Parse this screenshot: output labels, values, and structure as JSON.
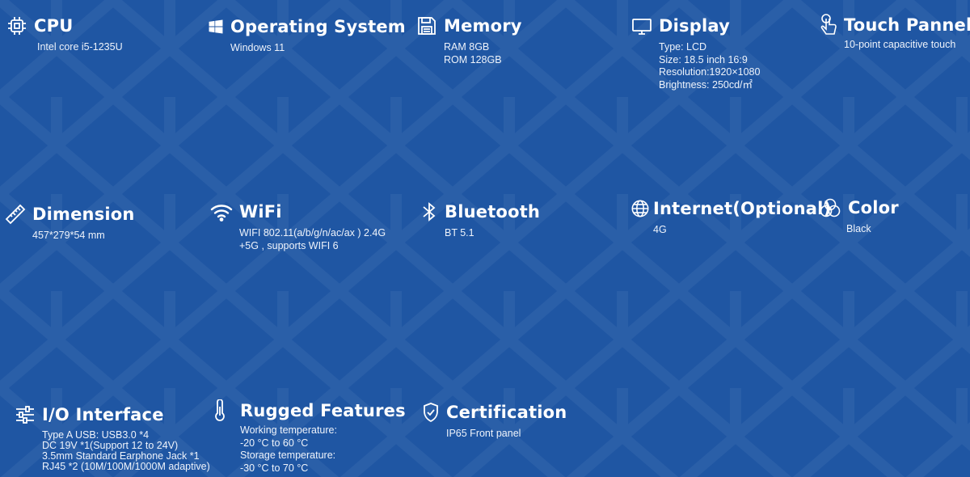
{
  "colors": {
    "background": "#1f56a3",
    "text": "#ffffff"
  },
  "specs": {
    "cpu": {
      "icon": "cpu-icon",
      "title": "CPU",
      "lines": [
        "Intel core i5-1235U"
      ]
    },
    "os": {
      "icon": "windows-icon",
      "title": "Operating System",
      "lines": [
        "Windows 11"
      ]
    },
    "memory": {
      "icon": "save-icon",
      "title": "Memory",
      "lines": [
        "RAM 8GB",
        "ROM 128GB"
      ]
    },
    "display": {
      "icon": "monitor-icon",
      "title": "Display",
      "lines": [
        "Type: LCD",
        "Size: 18.5 inch 16:9",
        "Resolution:1920×1080",
        "Brightness: 250cd/㎡"
      ]
    },
    "touch": {
      "icon": "touch-hand-icon",
      "title": "Touch Pannel",
      "lines": [
        "10-point capacitive touch"
      ]
    },
    "dimension": {
      "icon": "ruler-icon",
      "title": "Dimension",
      "lines": [
        "457*279*54 mm"
      ]
    },
    "wifi": {
      "icon": "wifi-icon",
      "title": "WiFi",
      "lines": [
        "WIFI 802.11(a/b/g/n/ac/ax ) 2.4G",
        "+5G , supports WIFI 6"
      ]
    },
    "bluetooth": {
      "icon": "bluetooth-icon",
      "title": "Bluetooth",
      "lines": [
        "BT 5.1"
      ]
    },
    "internet": {
      "icon": "globe-icon",
      "title": "Internet(Optional)",
      "lines": [
        "4G"
      ]
    },
    "color": {
      "icon": "color-circles-icon",
      "title": "Color",
      "lines": [
        "Black"
      ]
    },
    "io": {
      "icon": "sliders-icon",
      "title": "I/O Interface",
      "lines": [
        "Type A USB: USB3.0 *4",
        "DC 19V *1(Support 12 to 24V)",
        "3.5mm Standard Earphone Jack *1",
        "RJ45 *2 (10M/100M/1000M adaptive)"
      ]
    },
    "rugged": {
      "icon": "thermometer-icon",
      "title": "Rugged Features",
      "lines": [
        "Working temperature:",
        "-20 °C to 60 °C",
        "Storage temperature:",
        "-30 °C to 70 °C"
      ]
    },
    "certification": {
      "icon": "shield-check-icon",
      "title": "Certification",
      "lines": [
        "IP65 Front panel"
      ]
    }
  }
}
